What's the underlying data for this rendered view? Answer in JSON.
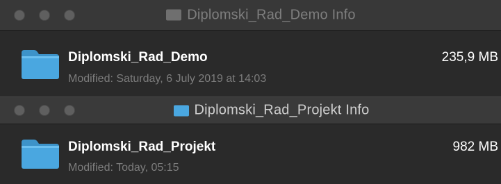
{
  "windows": [
    {
      "title": "Diplomski_Rad_Demo Info",
      "active": false,
      "item": {
        "name": "Diplomski_Rad_Demo",
        "modified": "Modified: Saturday, 6 July 2019 at 14:03",
        "size": "235,9 MB",
        "icon": "folder-icon"
      }
    },
    {
      "title": "Diplomski_Rad_Projekt Info",
      "active": true,
      "item": {
        "name": "Diplomski_Rad_Projekt",
        "modified": "Modified: Today, 05:15",
        "size": "982 MB",
        "icon": "folder-icon"
      }
    }
  ],
  "colors": {
    "background": "#2a2a2a",
    "titlebar": "#383838",
    "folder_blue": "#4aa7e0",
    "inactive_text": "#7e7e7e",
    "active_text": "#cfcfcf"
  }
}
